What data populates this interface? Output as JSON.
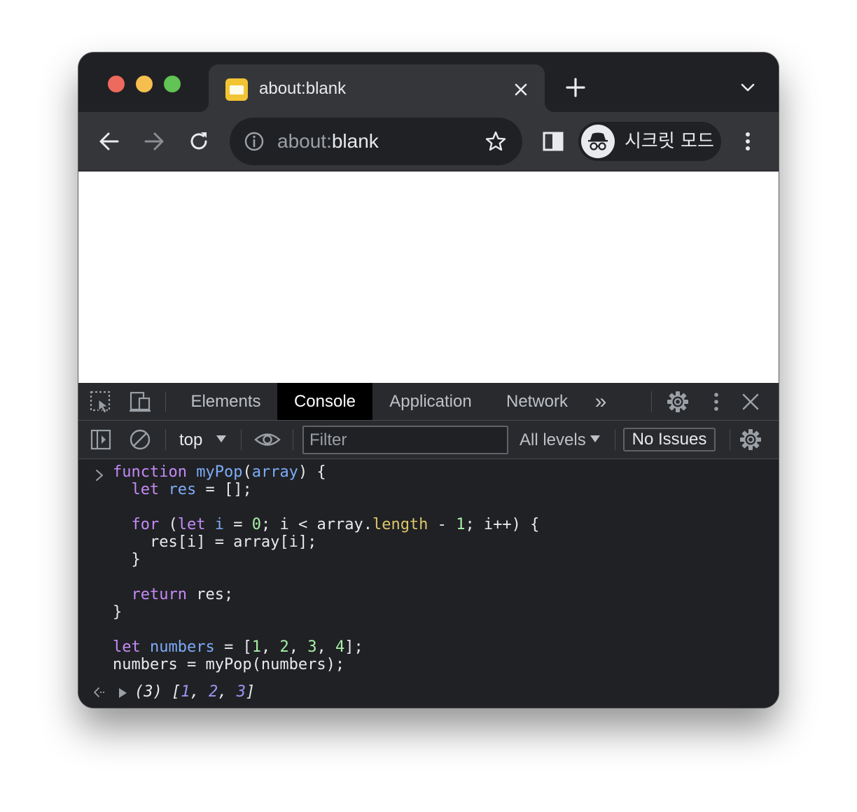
{
  "window": {
    "tab": {
      "title": "about:blank"
    },
    "address_bar": {
      "scheme": "about:",
      "host": "blank"
    },
    "incognito_label": "시크릿 모드"
  },
  "devtools": {
    "tabs": [
      {
        "label": "Elements",
        "active": false
      },
      {
        "label": "Console",
        "active": true
      },
      {
        "label": "Application",
        "active": false
      },
      {
        "label": "Network",
        "active": false
      }
    ],
    "more_tabs_glyph": "»",
    "filter_bar": {
      "context": "top",
      "filter_placeholder": "Filter",
      "levels": "All levels",
      "issues": "No Issues"
    },
    "console": {
      "code_lines": [
        [
          [
            "kw",
            "function"
          ],
          [
            "t",
            " "
          ],
          [
            "fn",
            "myPop"
          ],
          [
            "t",
            "("
          ],
          [
            "vr",
            "array"
          ],
          [
            "t",
            ") {"
          ]
        ],
        [
          [
            "t",
            "  "
          ],
          [
            "kw",
            "let"
          ],
          [
            "t",
            " "
          ],
          [
            "vr",
            "res"
          ],
          [
            "t",
            " = [];"
          ]
        ],
        [
          [
            "t",
            ""
          ]
        ],
        [
          [
            "t",
            "  "
          ],
          [
            "kw",
            "for"
          ],
          [
            "t",
            " ("
          ],
          [
            "kw",
            "let"
          ],
          [
            "t",
            " "
          ],
          [
            "vr",
            "i"
          ],
          [
            "t",
            " = "
          ],
          [
            "nm",
            "0"
          ],
          [
            "t",
            "; i < array."
          ],
          [
            "pr",
            "length"
          ],
          [
            "t",
            " - "
          ],
          [
            "nm",
            "1"
          ],
          [
            "t",
            "; i++) {"
          ]
        ],
        [
          [
            "t",
            "    res[i] = array[i];"
          ]
        ],
        [
          [
            "t",
            "  }"
          ]
        ],
        [
          [
            "t",
            ""
          ]
        ],
        [
          [
            "t",
            "  "
          ],
          [
            "kw",
            "return"
          ],
          [
            "t",
            " res;"
          ]
        ],
        [
          [
            "t",
            "}"
          ]
        ],
        [
          [
            "t",
            ""
          ]
        ],
        [
          [
            "kw",
            "let"
          ],
          [
            "t",
            " "
          ],
          [
            "vr",
            "numbers"
          ],
          [
            "t",
            " = ["
          ],
          [
            "nm",
            "1"
          ],
          [
            "t",
            ", "
          ],
          [
            "nm",
            "2"
          ],
          [
            "t",
            ", "
          ],
          [
            "nm",
            "3"
          ],
          [
            "t",
            ", "
          ],
          [
            "nm",
            "4"
          ],
          [
            "t",
            "];"
          ]
        ],
        [
          [
            "t",
            "numbers = myPop(numbers);"
          ]
        ]
      ],
      "result": {
        "count": "(3)",
        "values": [
          "1",
          "2",
          "3"
        ]
      }
    }
  },
  "colors": {
    "keyword": "#c58af9",
    "identifier": "#7cacf8",
    "number": "#a8f0a8",
    "property": "#dcc76a",
    "result_number": "#9d95f5",
    "traffic_red": "#ed6a5e",
    "traffic_yellow": "#f5bf4f",
    "traffic_green": "#61c454"
  },
  "icons": [
    "close-icon",
    "plus-icon",
    "chevron-down-icon",
    "back-arrow-icon",
    "forward-arrow-icon",
    "reload-icon",
    "info-icon",
    "star-icon",
    "side-panel-icon",
    "incognito-icon",
    "more-vert-icon",
    "inspect-element-icon",
    "device-toolbar-icon",
    "gear-icon",
    "sidebar-toggle-icon",
    "clear-console-icon",
    "eye-icon",
    "caret-down-icon",
    "prompt-chevron-icon",
    "result-arrow-icon",
    "expand-triangle-icon"
  ]
}
